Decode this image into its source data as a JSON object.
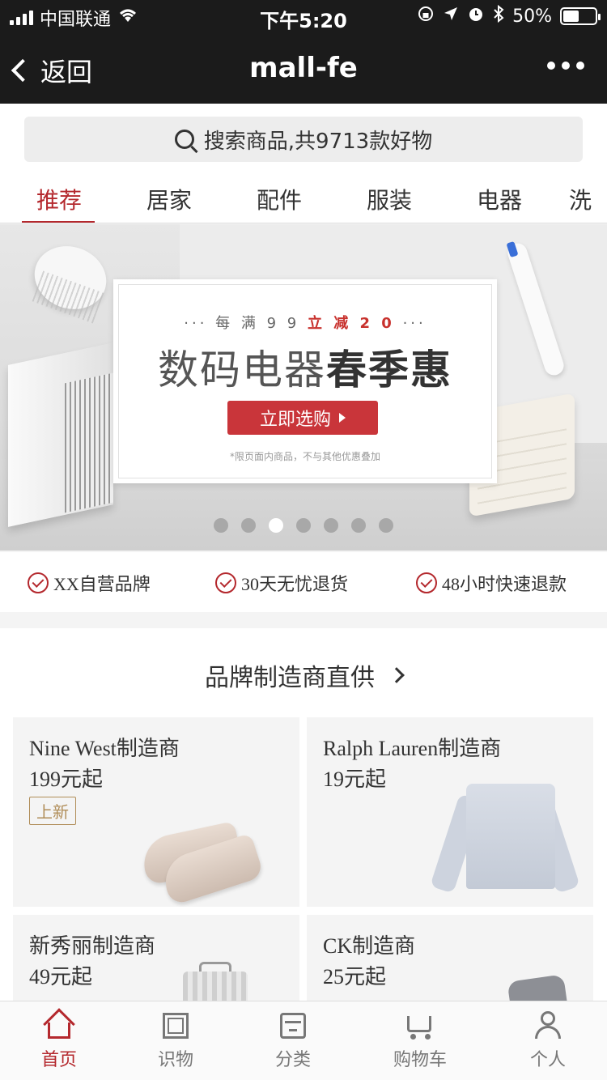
{
  "status_bar": {
    "carrier": "中国联通",
    "time": "下午5:20",
    "battery_level_text": "50%",
    "battery_fraction": 0.5
  },
  "navbar": {
    "back_label": "返回",
    "title": "mall-fe"
  },
  "search": {
    "placeholder": "搜索商品,共9713款好物"
  },
  "tabs": [
    {
      "label": "推荐",
      "active": true
    },
    {
      "label": "居家"
    },
    {
      "label": "配件"
    },
    {
      "label": "服装"
    },
    {
      "label": "电器"
    },
    {
      "label": "洗"
    }
  ],
  "banner": {
    "tagline_prefix": "··· 每 满 9 9",
    "tagline_highlight": "立 减 2 0",
    "tagline_suffix": "···",
    "headline_light": "数码电器",
    "headline_bold": "春季惠",
    "cta_label": "立即选购",
    "footnote": "*限页面内商品，不与其他优惠叠加",
    "dot_count": 7,
    "active_dot": 3
  },
  "promises": [
    {
      "label": "XX自营品牌"
    },
    {
      "label": "30天无忧退货"
    },
    {
      "label": "48小时快速退款"
    }
  ],
  "section": {
    "title": "品牌制造商直供",
    "cards": [
      {
        "name": "Nine West制造商",
        "price": "199元起",
        "badge": "上新"
      },
      {
        "name": "Ralph Lauren制造商",
        "price": "19元起"
      },
      {
        "name": "新秀丽制造商",
        "price": "49元起"
      },
      {
        "name": "CK制造商",
        "price": "25元起"
      }
    ]
  },
  "bottom_tabs": [
    {
      "label": "首页",
      "icon": "home-icon",
      "active": true
    },
    {
      "label": "识物",
      "icon": "discover-icon"
    },
    {
      "label": "分类",
      "icon": "category-icon"
    },
    {
      "label": "购物车",
      "icon": "cart-icon"
    },
    {
      "label": "个人",
      "icon": "user-icon"
    }
  ],
  "colors": {
    "accent": "#b4282d",
    "topbar": "#1b1b1b"
  }
}
